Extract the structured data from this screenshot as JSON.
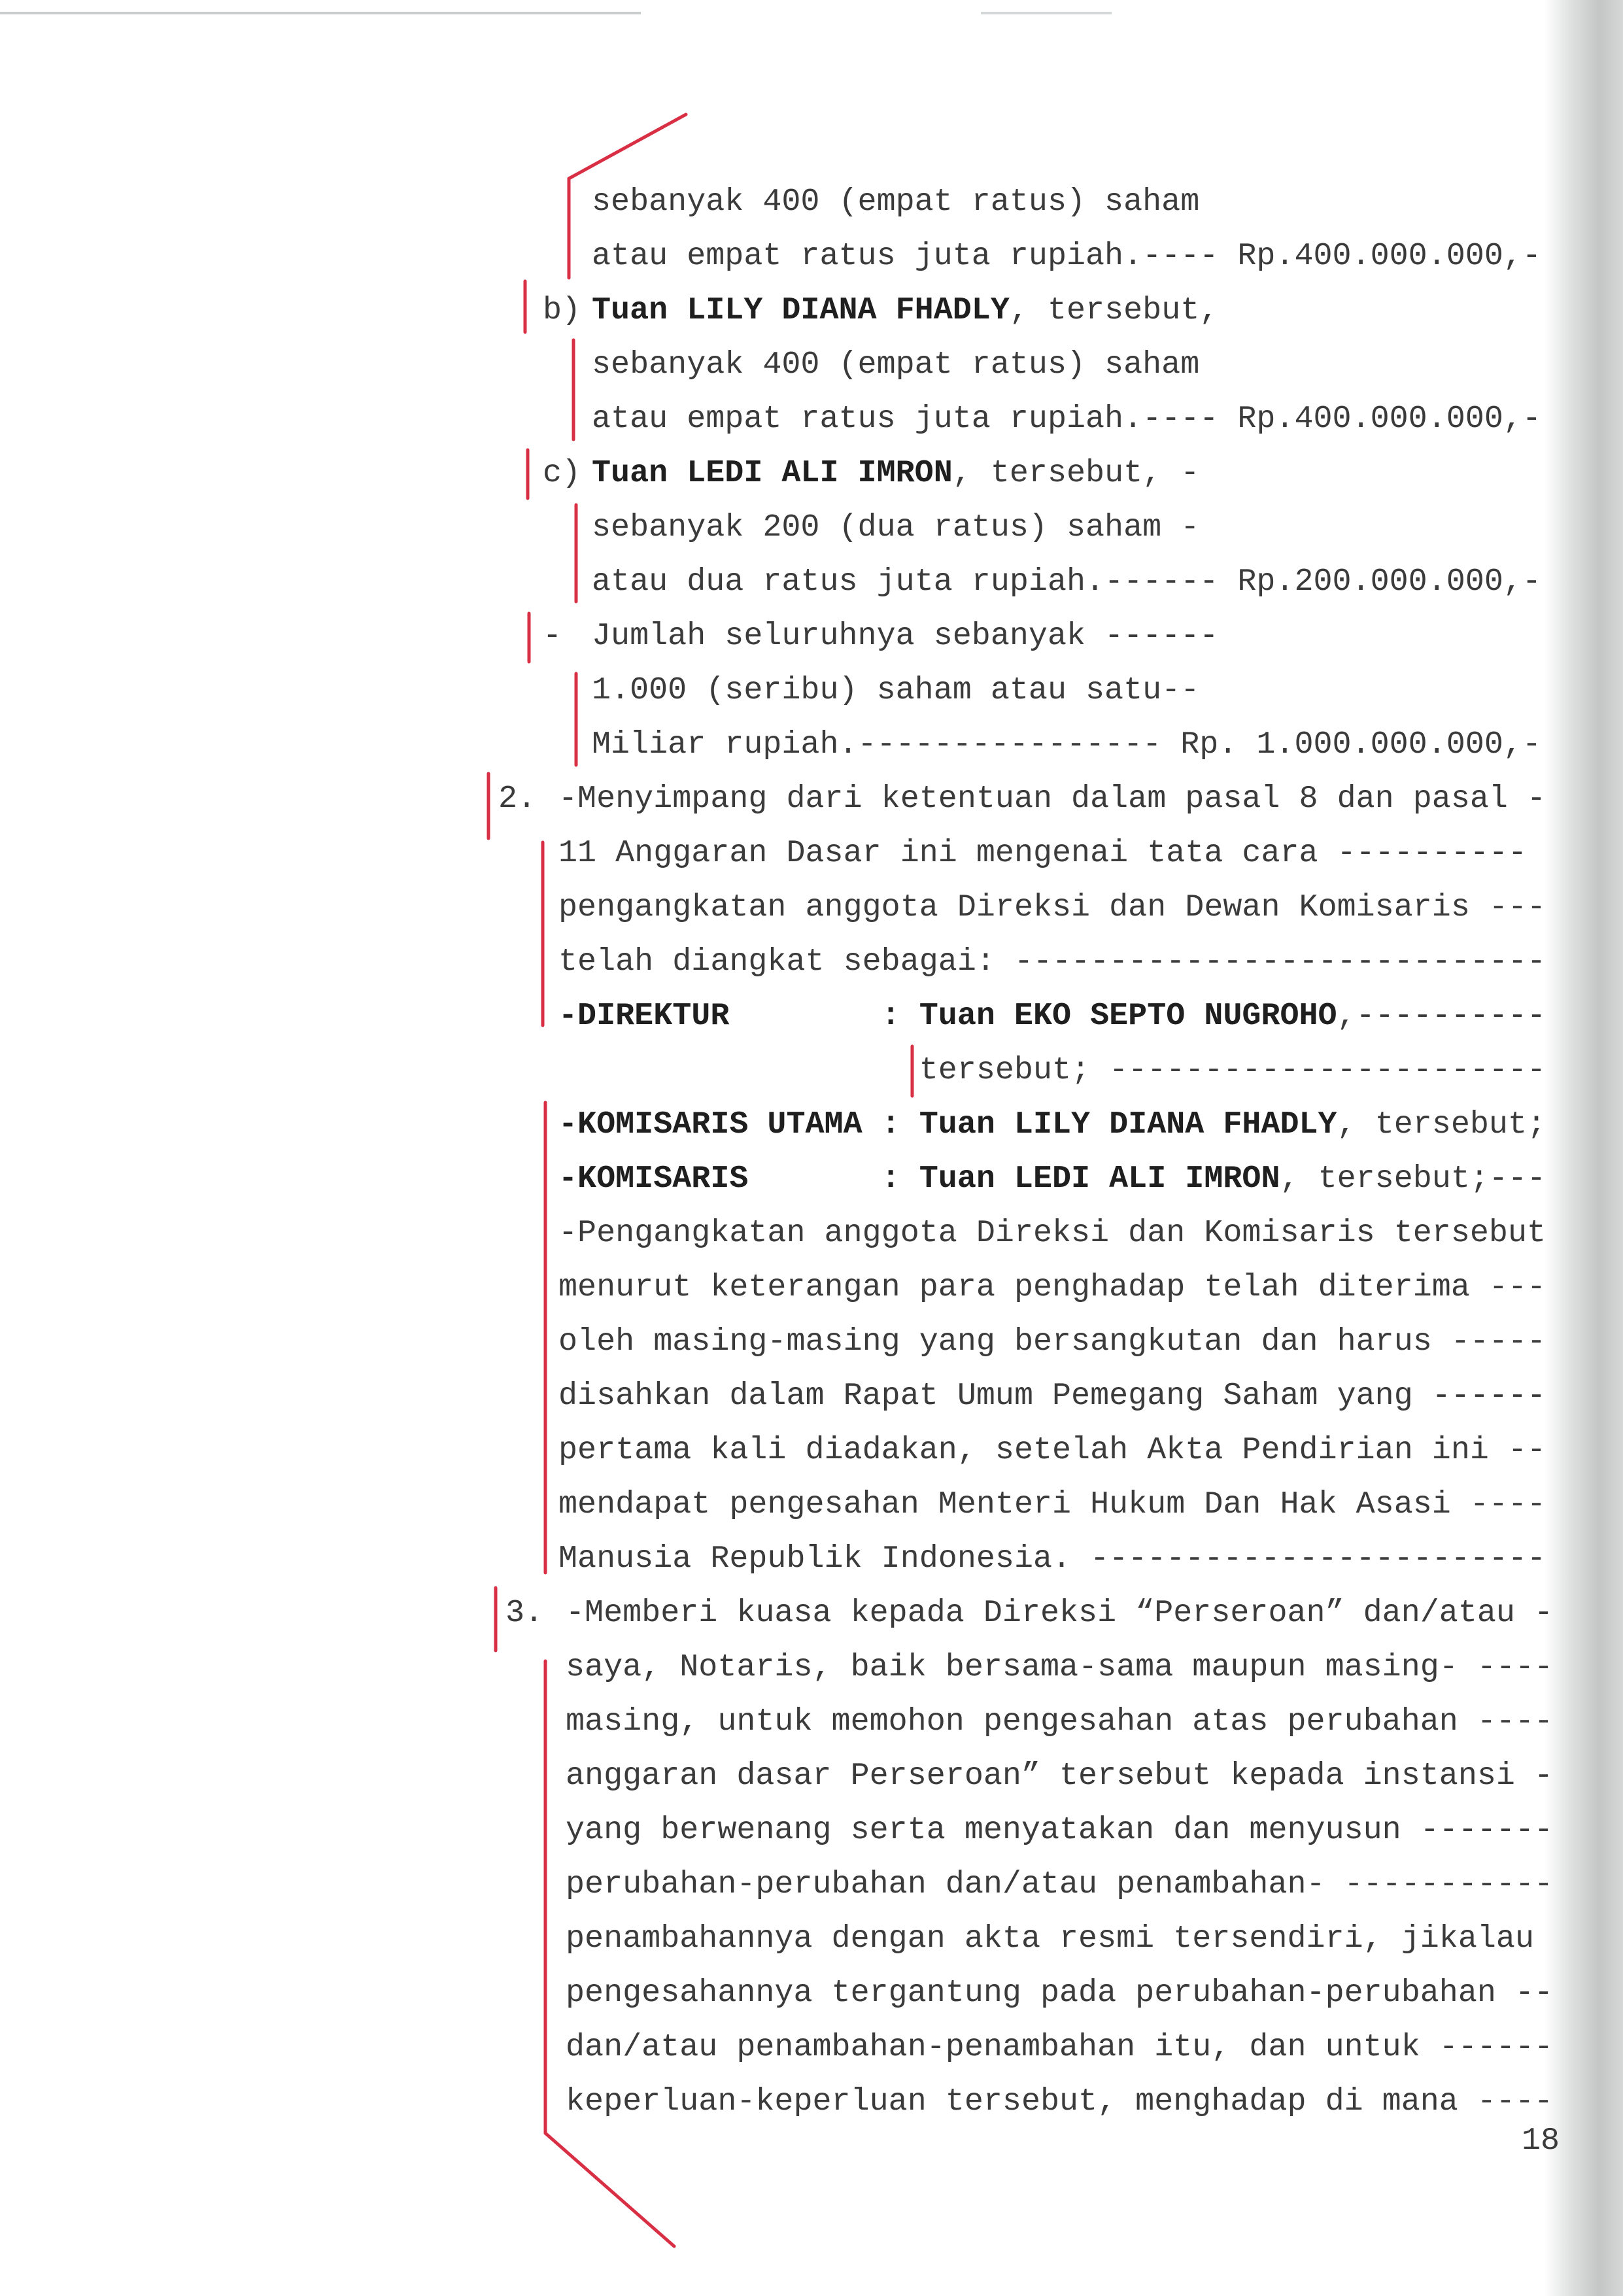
{
  "document": {
    "shares": {
      "a_continued": {
        "lines": [
          "sebanyak 400 (empat ratus) saham",
          "atau empat ratus juta rupiah.---- Rp.400.000.000,-"
        ]
      },
      "b": {
        "marker": "b)",
        "name": "Tuan LILY DIANA FHADLY",
        "after_name": ", tersebut,",
        "lines": [
          "sebanyak 400 (empat ratus) saham",
          "atau empat ratus juta rupiah.---- Rp.400.000.000,-"
        ]
      },
      "c": {
        "marker": "c)",
        "name": "Tuan LEDI ALI IMRON",
        "after_name": ", tersebut, -",
        "lines": [
          "sebanyak 200 (dua ratus) saham -",
          "atau dua ratus juta rupiah.------ Rp.200.000.000,-"
        ]
      },
      "total": {
        "marker": "-",
        "lines": [
          "Jumlah seluruhnya sebanyak ------",
          "1.000 (seribu) saham atau satu--",
          "Miliar rupiah.---------------- Rp. 1.000.000.000,-"
        ]
      }
    },
    "item_2": {
      "number": "2.",
      "lines": [
        "-Menyimpang dari ketentuan dalam pasal 8 dan pasal -",
        "11 Anggaran Dasar ini mengenai tata cara ----------",
        "pengangkatan anggota Direksi dan Dewan Komisaris ---",
        "telah diangkat sebagai: ----------------------------"
      ],
      "appointments": [
        {
          "role": "-DIREKTUR",
          "separator": ":",
          "name": "Tuan EKO SEPTO NUGROHO",
          "after_name": ",----------",
          "continuation": "tersebut; -----------------------"
        },
        {
          "role": "-KOMISARIS UTAMA",
          "separator": ":",
          "name": "Tuan LILY DIANA FHADLY",
          "after_name": ", tersebut;"
        },
        {
          "role": "-KOMISARIS",
          "separator": ":",
          "name": "Tuan LEDI ALI IMRON",
          "after_name": ", tersebut;---"
        }
      ],
      "closing_lines": [
        "-Pengangkatan anggota Direksi dan Komisaris tersebut",
        "menurut keterangan para penghadap telah diterima ---",
        "oleh masing-masing yang bersangkutan dan harus -----",
        "disahkan dalam Rapat Umum Pemegang Saham yang ------",
        "pertama kali diadakan, setelah Akta Pendirian ini --",
        "mendapat pengesahan Menteri Hukum Dan Hak Asasi ----",
        "Manusia Republik Indonesia. ------------------------"
      ]
    },
    "item_3": {
      "number": "3.",
      "lines": [
        "-Memberi kuasa kepada Direksi “Perseroan” dan/atau -",
        "saya, Notaris, baik bersama-sama maupun masing- ----",
        "masing, untuk memohon pengesahan atas perubahan ----",
        "anggaran dasar Perseroan” tersebut kepada instansi -",
        "yang berwenang serta menyatakan dan menyusun -------",
        "perubahan-perubahan dan/atau penambahan- -----------",
        "penambahannya dengan akta resmi tersendiri, jikalau",
        "pengesahannya tergantung pada perubahan-perubahan --",
        "dan/atau penambahan-penambahan itu, dan untuk ------",
        "keperluan-keperluan tersebut, menghadap di mana ----"
      ]
    },
    "page_number": "18"
  },
  "colors": {
    "paper": "#ffffff",
    "ink": "#3b3b3b",
    "bold_ink": "#1f1f1f",
    "annotation_red": "#d92f44"
  }
}
